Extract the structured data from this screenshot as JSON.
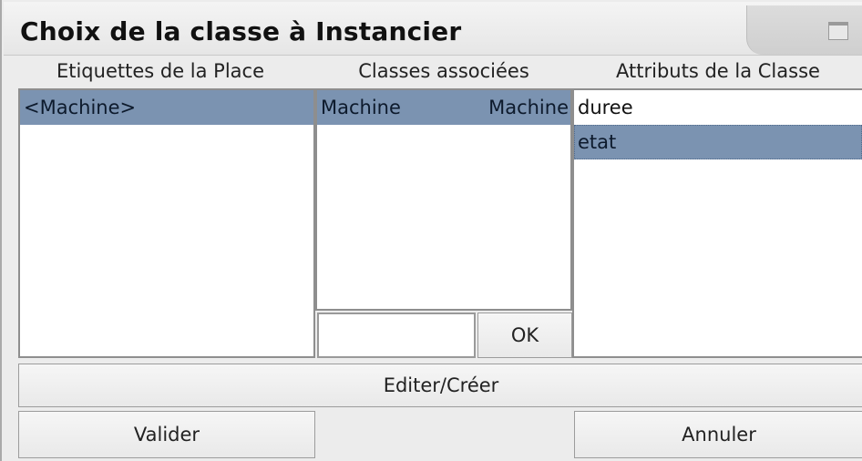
{
  "window": {
    "title": "Choix de la classe à Instancier"
  },
  "columns": {
    "etiquettes_header": "Etiquettes de la Place",
    "classes_header": "Classes associées",
    "attributs_header": "Attributs de la Classe"
  },
  "etiquettes": [
    {
      "label": "<Machine>",
      "selected": true
    }
  ],
  "classes": [
    {
      "name": "Machine",
      "type": "Machine",
      "selected": true
    }
  ],
  "attributs": [
    {
      "label": "duree",
      "selected": false
    },
    {
      "label": "etat",
      "selected": true
    }
  ],
  "class_input": {
    "value": ""
  },
  "buttons": {
    "ok": "OK",
    "edit_create": "Editer/Créer",
    "validate": "Valider",
    "cancel": "Annuler"
  },
  "colors": {
    "selection": "#7b93b1",
    "window_bg": "#ececec"
  }
}
